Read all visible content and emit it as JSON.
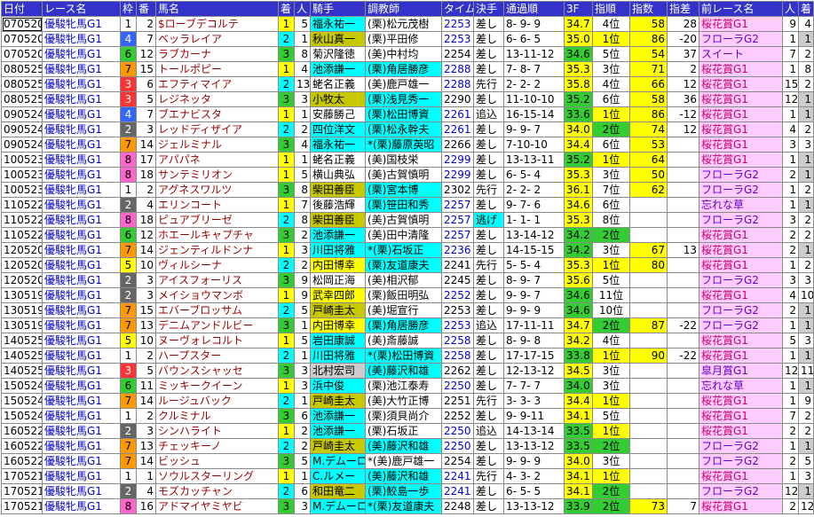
{
  "headers": [
    "日付",
    "レース名",
    "枠",
    "番",
    "馬名",
    "着",
    "人",
    "騎手",
    "調教師",
    "タイム",
    "決手",
    "通過順",
    "3F",
    "指順",
    "指数",
    "指差",
    "前レース名",
    "人",
    "着"
  ],
  "rows": [
    [
      "070520",
      "優駿牝馬G1",
      "1",
      "2",
      "$ローブデコルテ",
      "1",
      "5",
      "福永祐一",
      "(栗)松元茂樹",
      "2253",
      "差し",
      "8- 9- 9",
      "34.7",
      "4位",
      "58",
      "28",
      "桜花賞G1",
      "9",
      "4"
    ],
    [
      "070520",
      "優駿牝馬G1",
      "4",
      "7",
      "ベッラレイア",
      "2",
      "1",
      "秋山真一",
      "(栗)平田修",
      "2253",
      "差し",
      "6- 6- 5",
      "35.0",
      "1位",
      "86",
      "-20",
      "フローラG2",
      "1",
      "1"
    ],
    [
      "070520",
      "優駿牝馬G1",
      "6",
      "12",
      "ラブカーナ",
      "3",
      "8",
      "菊沢隆徳",
      "(美)中村均",
      "2254",
      "差し",
      "13-11-12",
      "34.6",
      "5位",
      "54",
      "37",
      "スイート",
      "7",
      "2"
    ],
    [
      "080525",
      "優駿牝馬G1",
      "7",
      "15",
      "トールポピー",
      "1",
      "4",
      "池添謙一",
      "(栗)角居勝彦",
      "2288",
      "差し",
      "7- 8- 7",
      "35.3",
      "3位",
      "71",
      "2",
      "桜花賞G1",
      "1",
      "8"
    ],
    [
      "080525",
      "優駿牝馬G1",
      "3",
      "6",
      "エフティマイア",
      "2",
      "13",
      "蛯名正義",
      "(美)鹿戸雄一",
      "2288",
      "先行",
      "2- 2- 2",
      "35.8",
      "4位",
      "66",
      "12",
      "桜花賞G1",
      "15",
      "2"
    ],
    [
      "080525",
      "優駿牝馬G1",
      "3",
      "5",
      "レジネッタ",
      "3",
      "3",
      "小牧太",
      "(栗)浅見秀一",
      "2290",
      "差し",
      "11-10-10",
      "35.2",
      "6位",
      "58",
      "36",
      "桜花賞G1",
      "12",
      "1"
    ],
    [
      "090524",
      "優駿牝馬G1",
      "4",
      "7",
      "ブエナビスタ",
      "1",
      "1",
      "安藤勝己",
      "(栗)松田博資",
      "2261",
      "追込",
      "16-15-14",
      "33.6",
      "1位",
      "86",
      "-12",
      "桜花賞G1",
      "1",
      "1"
    ],
    [
      "090524",
      "優駿牝馬G1",
      "2",
      "3",
      "レッドディザイア",
      "2",
      "2",
      "四位洋文",
      "(栗)松永幹夫",
      "2261",
      "差し",
      "9- 9- 7",
      "34.0",
      "2位",
      "74",
      "12",
      "桜花賞G1",
      "4",
      "2"
    ],
    [
      "090524",
      "優駿牝馬G1",
      "7",
      "14",
      "ジェルミナル",
      "3",
      "4",
      "福永祐一",
      "*(栗)藤原英昭",
      "2266",
      "差し",
      "7-10-10",
      "34.4",
      "6位",
      "53",
      "",
      "桜花賞G1",
      "3",
      "3"
    ],
    [
      "100523",
      "優駿牝馬G1",
      "8",
      "17",
      "アパパネ",
      "1",
      "1",
      "蛯名正義",
      "(美)国枝栄",
      "2299",
      "差し",
      "13-13-11",
      "35.2",
      "1位",
      "64",
      "",
      "桜花賞G1",
      "1",
      "1"
    ],
    [
      "100523",
      "優駿牝馬G1",
      "8",
      "18",
      "サンテミリオン",
      "1",
      "5",
      "横山典弘",
      "(美)古賀慎明",
      "2299",
      "差し",
      "6- 5- 4",
      "35.3",
      "3位",
      "50",
      "",
      "フローラG2",
      "2",
      "1"
    ],
    [
      "100523",
      "優駿牝馬G1",
      "1",
      "2",
      "アグネスワルツ",
      "3",
      "8",
      "柴田善臣",
      "(栗)宮本博",
      "2302",
      "先行",
      "2- 2- 2",
      "36.1",
      "7位",
      "62",
      "",
      "フローラG2",
      "1",
      "2"
    ],
    [
      "110522",
      "優駿牝馬G1",
      "2",
      "4",
      "エリンコート",
      "1",
      "7",
      "後藤浩輝",
      "(栗)笹田和秀",
      "2257",
      "差し",
      "9- 7- 6",
      "34.6",
      "6位",
      "",
      "",
      "忘れな草",
      "1",
      "1"
    ],
    [
      "110522",
      "優駿牝馬G1",
      "8",
      "18",
      "ピュアブリーゼ",
      "2",
      "8",
      "柴田善臣",
      "(美)古賀慎明",
      "2257",
      "逃げ",
      "1- 1- 1",
      "35.3",
      "8位",
      "",
      "",
      "フローラG2",
      "3",
      "2"
    ],
    [
      "110522",
      "優駿牝馬G1",
      "6",
      "12",
      "ホエールキャプチャ",
      "3",
      "2",
      "池添謙一",
      "(美)田中清隆",
      "2257",
      "差し",
      "13-14-12",
      "34.2",
      "2位",
      "",
      "",
      "桜花賞G1",
      "2",
      "2"
    ],
    [
      "120520",
      "優駿牝馬G1",
      "7",
      "14",
      "ジェンティルドンナ",
      "1",
      "3",
      "川田将雅",
      "*(栗)石坂正",
      "2236",
      "差し",
      "14-15-15",
      "34.2",
      "3位",
      "67",
      "13",
      "桜花賞G1",
      "2",
      "1"
    ],
    [
      "120520",
      "優駿牝馬G1",
      "5",
      "10",
      "ヴィルシーナ",
      "2",
      "2",
      "内田博幸",
      "(栗)友道康夫",
      "2241",
      "先行",
      "5- 5- 4",
      "35.3",
      "1位",
      "80",
      "",
      "桜花賞G1",
      "1",
      "2"
    ],
    [
      "120520",
      "優駿牝馬G1",
      "2",
      "3",
      "アイスフォーリス",
      "3",
      "9",
      "松岡正海",
      "(美)相沢郁",
      "2245",
      "差し",
      "8- 9- 7",
      "35.6",
      "5位",
      "",
      "",
      "フローラG2",
      "3",
      "3"
    ],
    [
      "130519",
      "優駿牝馬G1",
      "2",
      "3",
      "メイショウマンボ",
      "1",
      "9",
      "武幸四郎",
      "(栗)飯田明弘",
      "2252",
      "差し",
      "9- 9- 7",
      "34.6",
      "11位",
      "",
      "",
      "桜花賞G1",
      "4",
      "10"
    ],
    [
      "130519",
      "優駿牝馬G1",
      "7",
      "15",
      "エバーブロッサム",
      "2",
      "5",
      "戸崎圭太",
      "(美)堀宣行",
      "2253",
      "差し",
      "9- 9- 9",
      "34.6",
      "10位",
      "",
      "",
      "フローラG2",
      "2",
      "1"
    ],
    [
      "130519",
      "優駿牝馬G1",
      "7",
      "13",
      "デニムアンドルビー",
      "3",
      "1",
      "内田博幸",
      "(栗)角居勝彦",
      "2253",
      "追込",
      "17-11-11",
      "34.7",
      "2位",
      "87",
      "-22",
      "フローラG2",
      "1",
      "1"
    ],
    [
      "140525",
      "優駿牝馬G1",
      "5",
      "10",
      "ヌーヴォレコルト",
      "1",
      "5",
      "岩田康誠",
      "(美)斎藤誠",
      "2258",
      "差し",
      "8- 9- 8",
      "34.2",
      "4位",
      "",
      "",
      "桜花賞G1",
      "5",
      "3"
    ],
    [
      "140525",
      "優駿牝馬G1",
      "1",
      "2",
      "ハープスター",
      "2",
      "1",
      "川田将雅",
      "*(栗)松田博資",
      "2258",
      "差し",
      "17-17-15",
      "33.8",
      "1位",
      "90",
      "-22",
      "桜花賞G1",
      "1",
      "1"
    ],
    [
      "140525",
      "優駿牝馬G1",
      "3",
      "5",
      "バウンスシャッセ",
      "3",
      "3",
      "北村宏司",
      "(美)藤沢和雄",
      "2262",
      "差し",
      "12-13-12",
      "34.5",
      "3位",
      "",
      "",
      "皐月賞G1",
      "12",
      "11"
    ],
    [
      "150524",
      "優駿牝馬G1",
      "6",
      "11",
      "ミッキークイーン",
      "1",
      "3",
      "浜中俊",
      "(栗)池江泰寿",
      "2250",
      "差し",
      "7- 7- 7",
      "34.0",
      "3位",
      "",
      "",
      "忘れな草",
      "1",
      "1"
    ],
    [
      "150524",
      "優駿牝馬G1",
      "7",
      "14",
      "ルージュバック",
      "2",
      "1",
      "戸崎圭太",
      "(美)大竹正博",
      "2251",
      "先行",
      "3- 3- 3",
      "34.4",
      "1位",
      "",
      "",
      "桜花賞G1",
      "1",
      "9"
    ],
    [
      "150524",
      "優駿牝馬G1",
      "1",
      "2",
      "クルミナル",
      "3",
      "6",
      "池添謙一",
      "(栗)須貝尚介",
      "2252",
      "差し",
      "9- 9-11",
      "34.1",
      "5位",
      "",
      "",
      "桜花賞G1",
      "7",
      "2"
    ],
    [
      "160522",
      "優駿牝馬G1",
      "2",
      "3",
      "シンハライト",
      "1",
      "2",
      "池添謙一",
      "(栗)石坂正",
      "2250",
      "追込",
      "14-13-14",
      "33.5",
      "1位",
      "",
      "",
      "桜花賞G1",
      "2",
      "2"
    ],
    [
      "160522",
      "優駿牝馬G1",
      "7",
      "13",
      "チェッキーノ",
      "2",
      "2",
      "戸崎圭太",
      "(美)藤沢和雄",
      "2250",
      "差し",
      "13-13-12",
      "33.5",
      "2位",
      "",
      "",
      "フローラG2",
      "1",
      "1"
    ],
    [
      "160522",
      "優駿牝馬G1",
      "7",
      "14",
      "ビッシュ",
      "3",
      "5",
      "M.デムーロ",
      "*(美)鹿戸雄一",
      "2254",
      "差し",
      "9- 9- 9",
      "34.0",
      "3位",
      "",
      "",
      "フローラG2",
      "2",
      "5"
    ],
    [
      "170521",
      "優駿牝馬G1",
      "1",
      "1",
      "ソウルスターリング",
      "1",
      "1",
      "C.ルメー",
      "(美)藤沢和雄",
      "2241",
      "先行",
      "4- 3- 2",
      "34.1",
      "1位",
      "",
      "",
      "桜花賞G1",
      "1",
      "3"
    ],
    [
      "170521",
      "優駿牝馬G1",
      "2",
      "4",
      "モズカッチャン",
      "2",
      "6",
      "和田竜二",
      "(栗)鮫島一歩",
      "2241",
      "差し",
      "6- 5- 5",
      "34.1",
      "2位",
      "",
      "",
      "フローラG2",
      "12",
      "1"
    ],
    [
      "170521",
      "優駿牝馬G1",
      "8",
      "16",
      "アドマイヤミヤビ",
      "3",
      "3",
      "M.デムーロ",
      "*(栗)友道康夫",
      "2248",
      "差し",
      "13-13-12",
      "33.9",
      "2位",
      "73",
      "7",
      "桜花賞G1",
      "2",
      "12"
    ]
  ]
}
